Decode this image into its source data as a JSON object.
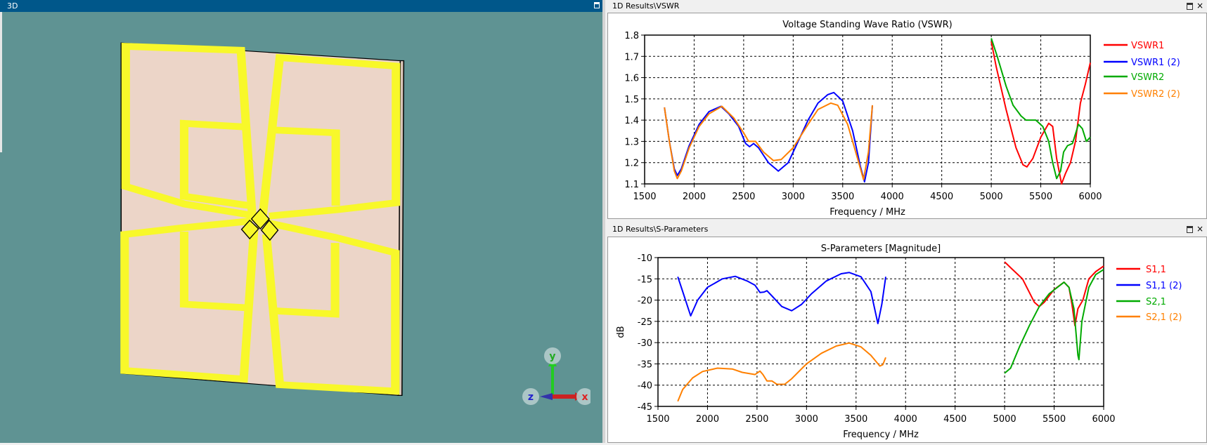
{
  "view3d": {
    "title": "3D",
    "colors": {
      "background": "#5f9393",
      "substrate": "#ecd5c8",
      "metal": "#f8f82a",
      "header": "#00578a"
    },
    "axes": {
      "x": "x",
      "y": "y",
      "z": "z"
    }
  },
  "vswr_panel": {
    "title": "1D Results\\VSWR",
    "close": "×"
  },
  "sparam_panel": {
    "title": "1D Results\\S-Parameters",
    "close": "×"
  },
  "chart_data": [
    {
      "type": "line",
      "title": "Voltage Standing Wave Ratio (VSWR)",
      "xlabel": "Frequency / MHz",
      "ylabel": "",
      "xlim": [
        1500,
        6000
      ],
      "ylim": [
        1.1,
        1.8
      ],
      "xticks": [
        1500,
        2000,
        2500,
        3000,
        3500,
        4000,
        4500,
        5000,
        5500,
        6000
      ],
      "yticks": [
        "1.1",
        "1.2",
        "1.3",
        "1.4",
        "1.5",
        "1.6",
        "1.7",
        "1.8"
      ],
      "grid": true,
      "legend": "right",
      "series": [
        {
          "name": "VSWR1",
          "color": "#ff0000",
          "x": [
            5000,
            5050,
            5150,
            5250,
            5320,
            5360,
            5420,
            5500,
            5580,
            5620,
            5660,
            5710,
            5750,
            5800,
            5850,
            5900,
            5950,
            6000
          ],
          "y": [
            1.77,
            1.65,
            1.45,
            1.27,
            1.19,
            1.18,
            1.22,
            1.32,
            1.385,
            1.37,
            1.22,
            1.1,
            1.15,
            1.2,
            1.3,
            1.48,
            1.57,
            1.67
          ]
        },
        {
          "name": "VSWR1 (2)",
          "color": "#0000ff",
          "x": [
            1700,
            1750,
            1800,
            1830,
            1870,
            1950,
            2050,
            2150,
            2270,
            2350,
            2450,
            2520,
            2560,
            2600,
            2650,
            2750,
            2850,
            2950,
            3050,
            3150,
            3250,
            3350,
            3410,
            3500,
            3600,
            3680,
            3720,
            3760,
            3800
          ],
          "y": [
            1.46,
            1.3,
            1.17,
            1.14,
            1.17,
            1.28,
            1.38,
            1.44,
            1.465,
            1.43,
            1.37,
            1.29,
            1.275,
            1.29,
            1.27,
            1.2,
            1.16,
            1.2,
            1.3,
            1.4,
            1.48,
            1.52,
            1.53,
            1.49,
            1.35,
            1.18,
            1.11,
            1.2,
            1.47
          ]
        },
        {
          "name": "VSWR2",
          "color": "#00aa00",
          "x": [
            5000,
            5060,
            5150,
            5220,
            5300,
            5350,
            5450,
            5520,
            5580,
            5620,
            5660,
            5700,
            5730,
            5770,
            5820,
            5880,
            5920,
            5960,
            6000
          ],
          "y": [
            1.785,
            1.7,
            1.56,
            1.47,
            1.42,
            1.4,
            1.4,
            1.37,
            1.3,
            1.2,
            1.125,
            1.16,
            1.25,
            1.28,
            1.29,
            1.38,
            1.36,
            1.3,
            1.32
          ]
        },
        {
          "name": "VSWR2 (2)",
          "color": "#ff8000",
          "x": [
            1700,
            1750,
            1800,
            1830,
            1870,
            1950,
            2050,
            2150,
            2280,
            2400,
            2500,
            2550,
            2620,
            2700,
            2800,
            2880,
            3000,
            3150,
            3250,
            3380,
            3450,
            3550,
            3650,
            3710,
            3760,
            3800
          ],
          "y": [
            1.46,
            1.3,
            1.16,
            1.125,
            1.16,
            1.27,
            1.37,
            1.43,
            1.465,
            1.41,
            1.34,
            1.3,
            1.3,
            1.25,
            1.21,
            1.215,
            1.27,
            1.38,
            1.45,
            1.48,
            1.47,
            1.38,
            1.22,
            1.12,
            1.25,
            1.47
          ]
        }
      ]
    },
    {
      "type": "line",
      "title": "S-Parameters [Magnitude]",
      "xlabel": "Frequency / MHz",
      "ylabel": "dB",
      "xlim": [
        1500,
        6000
      ],
      "ylim": [
        -45,
        -10
      ],
      "xticks": [
        1500,
        2000,
        2500,
        3000,
        3500,
        4000,
        4500,
        5000,
        5500,
        6000
      ],
      "yticks": [
        "-45",
        "-40",
        "-35",
        "-30",
        "-25",
        "-20",
        "-15",
        "-10"
      ],
      "grid": true,
      "legend": "right",
      "series": [
        {
          "name": "S1,1",
          "color": "#ff0000",
          "x": [
            5000,
            5080,
            5180,
            5300,
            5350,
            5400,
            5500,
            5600,
            5650,
            5680,
            5710,
            5740,
            5790,
            5850,
            5920,
            6000
          ],
          "y": [
            -11,
            -12.8,
            -15,
            -20.5,
            -21.5,
            -20.5,
            -17.5,
            -15.8,
            -17,
            -21,
            -26,
            -22,
            -20,
            -15,
            -13.3,
            -12
          ]
        },
        {
          "name": "S1,1 (2)",
          "color": "#0000ff",
          "x": [
            1700,
            1750,
            1830,
            1900,
            2000,
            2150,
            2280,
            2400,
            2480,
            2530,
            2570,
            2600,
            2650,
            2750,
            2850,
            2950,
            3050,
            3200,
            3350,
            3430,
            3550,
            3650,
            3720,
            3760,
            3800
          ],
          "y": [
            -14.5,
            -18,
            -23.7,
            -20,
            -17,
            -15,
            -14.4,
            -15.5,
            -16.5,
            -18.2,
            -18.1,
            -17.8,
            -19,
            -21.5,
            -22.5,
            -21,
            -18.5,
            -15.5,
            -13.8,
            -13.5,
            -14.5,
            -18,
            -25.5,
            -21,
            -14.5
          ]
        },
        {
          "name": "S2,1",
          "color": "#00aa00",
          "x": [
            5000,
            5060,
            5150,
            5250,
            5350,
            5450,
            5600,
            5650,
            5700,
            5740,
            5750,
            5780,
            5850,
            5920,
            6000
          ],
          "y": [
            -37.2,
            -36,
            -31,
            -26,
            -21.5,
            -18.5,
            -15.8,
            -17,
            -22,
            -33,
            -34,
            -25,
            -17,
            -14,
            -12.8
          ]
        },
        {
          "name": "S2,1 (2)",
          "color": "#ff8000",
          "x": [
            1700,
            1750,
            1850,
            1950,
            2100,
            2250,
            2350,
            2480,
            2530,
            2560,
            2600,
            2650,
            2700,
            2780,
            2850,
            3000,
            3150,
            3300,
            3430,
            3550,
            3650,
            3740,
            3770,
            3800
          ],
          "y": [
            -43.8,
            -41,
            -38.3,
            -36.8,
            -36,
            -36.2,
            -37,
            -37.5,
            -36.7,
            -37.5,
            -39,
            -39,
            -39.8,
            -39.8,
            -38.5,
            -35,
            -32.5,
            -30.8,
            -30.1,
            -31,
            -33,
            -35.5,
            -35.2,
            -33.5
          ]
        }
      ]
    }
  ]
}
